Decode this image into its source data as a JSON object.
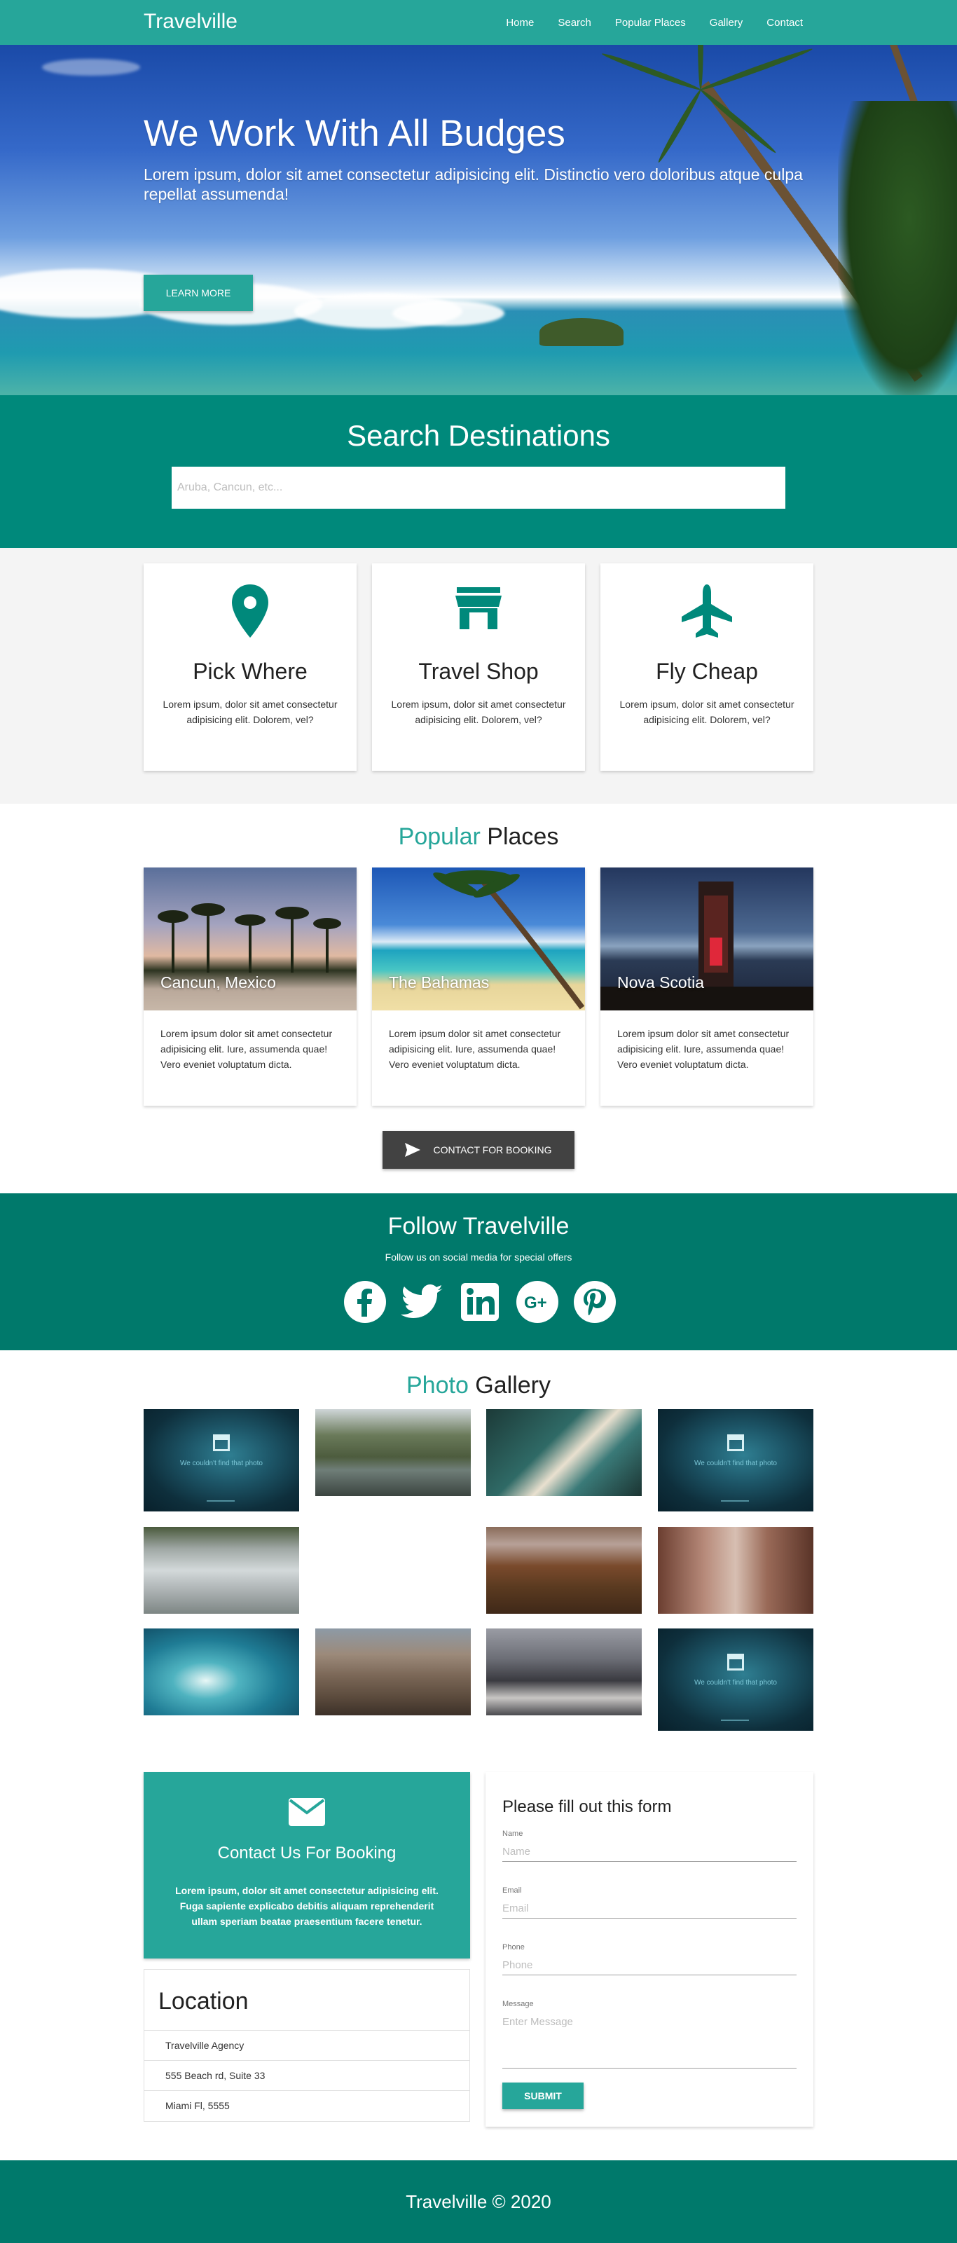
{
  "nav": {
    "brand": "Travelville",
    "links": [
      "Home",
      "Search",
      "Popular Places",
      "Gallery",
      "Contact"
    ]
  },
  "hero": {
    "title": "We Work With All Budges",
    "text": "Lorem ipsum, dolor sit amet consectetur adipisicing elit. Distinctio vero doloribus atque culpa repellat assumenda!",
    "button": "Learn More"
  },
  "search": {
    "title": "Search Destinations",
    "placeholder": "Aruba, Cancun, etc..."
  },
  "features": [
    {
      "icon": "map-pin-icon",
      "title": "Pick Where",
      "text": "Lorem ipsum, dolor sit amet consectetur adipisicing elit. Dolorem, vel?"
    },
    {
      "icon": "store-icon",
      "title": "Travel Shop",
      "text": "Lorem ipsum, dolor sit amet consectetur adipisicing elit. Dolorem, vel?"
    },
    {
      "icon": "airplane-icon",
      "title": "Fly Cheap",
      "text": "Lorem ipsum, dolor sit amet consectetur adipisicing elit. Dolorem, vel?"
    }
  ],
  "popular": {
    "title_accent": "Popular",
    "title_rest": " Places",
    "places": [
      {
        "name": "Cancun, Mexico",
        "text": "Lorem ipsum dolor sit amet consectetur adipisicing elit. Iure, assumenda quae! Vero eveniet voluptatum dicta."
      },
      {
        "name": "The Bahamas",
        "text": "Lorem ipsum dolor sit amet consectetur adipisicing elit. Iure, assumenda quae! Vero eveniet voluptatum dicta."
      },
      {
        "name": "Nova Scotia",
        "text": "Lorem ipsum dolor sit amet consectetur adipisicing elit. Iure, assumenda quae! Vero eveniet voluptatum dicta."
      }
    ],
    "button": "Contact For Booking"
  },
  "follow": {
    "title": "Follow Travelville",
    "subtitle": "Follow us on social media for special offers",
    "networks": [
      "facebook-icon",
      "twitter-icon",
      "linkedin-icon",
      "google-plus-icon",
      "pinterest-icon"
    ]
  },
  "gallery": {
    "title_accent": "Photo",
    "title_rest": " Gallery",
    "missing_text": "We couldn't find that photo"
  },
  "contact": {
    "title": "Contact Us For Booking",
    "text": "Lorem ipsum, dolor sit amet consectetur adipisicing elit. Fuga sapiente explicabo debitis aliquam reprehenderit ullam speriam beatae praesentium facere tenetur.",
    "location_title": "Location",
    "location_lines": [
      "Travelville Agency",
      "555 Beach rd, Suite 33",
      "Miami Fl, 5555"
    ]
  },
  "form": {
    "title": "Please fill out this form",
    "fields": [
      {
        "label": "Name",
        "placeholder": "Name"
      },
      {
        "label": "Email",
        "placeholder": "Email"
      },
      {
        "label": "Phone",
        "placeholder": "Phone"
      },
      {
        "label": "Message",
        "placeholder": "Enter Message"
      }
    ],
    "submit": "Submit"
  },
  "footer": {
    "text": "Travelville © 2020"
  },
  "colors": {
    "primary": "#26a69a",
    "dark_teal": "#00796b",
    "search_bg": "#00897b",
    "dark_button": "#424242"
  }
}
